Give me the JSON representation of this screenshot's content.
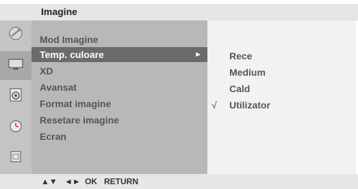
{
  "title": "Imagine",
  "icons": [
    "satellite-dish-icon",
    "tv-screen-icon",
    "speaker-icon",
    "clock-icon",
    "lock-icon"
  ],
  "menu": {
    "items": [
      {
        "label": "Mod Imagine"
      },
      {
        "label": "Temp. culoare",
        "selected": true
      },
      {
        "label": "XD"
      },
      {
        "label": "Avansat"
      },
      {
        "label": "Format imagine"
      },
      {
        "label": "Resetare imagine"
      },
      {
        "label": "Ecran"
      }
    ],
    "submenu_arrow": "►"
  },
  "options": {
    "items": [
      {
        "label": "Rece"
      },
      {
        "label": "Medium"
      },
      {
        "label": "Cald"
      },
      {
        "label": "Utilizator",
        "checked": true
      }
    ],
    "check_mark": "√"
  },
  "footer": {
    "updown": "▲▼",
    "leftright": "◄►",
    "ok": "OK",
    "return": "RETURN"
  }
}
